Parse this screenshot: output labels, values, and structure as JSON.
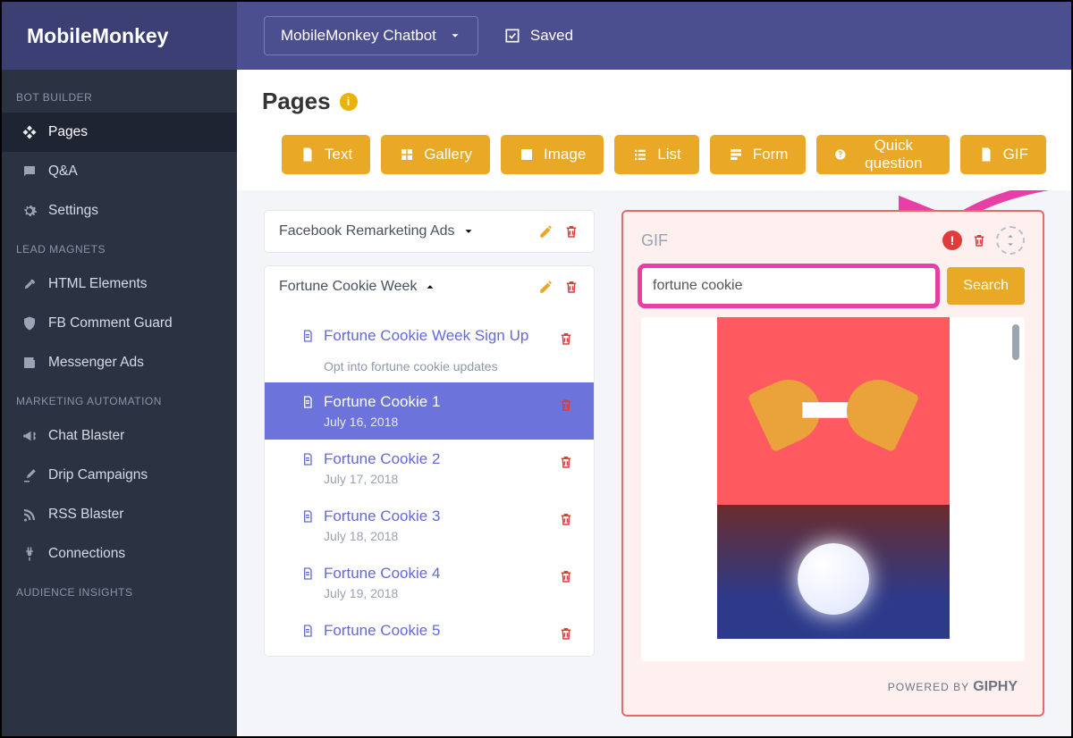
{
  "brand": "MobileMonkey",
  "topbar": {
    "bot_name": "MobileMonkey Chatbot",
    "saved_label": "Saved"
  },
  "sidebar": {
    "sections": [
      {
        "label": "BOT BUILDER",
        "items": [
          {
            "label": "Pages",
            "icon": "diamond-icon",
            "active": true
          },
          {
            "label": "Q&A",
            "icon": "chat-icon"
          },
          {
            "label": "Settings",
            "icon": "gear-icon"
          }
        ]
      },
      {
        "label": "LEAD MAGNETS",
        "items": [
          {
            "label": "HTML Elements",
            "icon": "rocket-icon"
          },
          {
            "label": "FB Comment Guard",
            "icon": "shield-icon"
          },
          {
            "label": "Messenger Ads",
            "icon": "news-icon"
          }
        ]
      },
      {
        "label": "MARKETING AUTOMATION",
        "items": [
          {
            "label": "Chat Blaster",
            "icon": "megaphone-icon"
          },
          {
            "label": "Drip Campaigns",
            "icon": "dropper-icon"
          },
          {
            "label": "RSS Blaster",
            "icon": "rss-icon"
          },
          {
            "label": "Connections",
            "icon": "plug-icon"
          }
        ]
      },
      {
        "label": "AUDIENCE INSIGHTS",
        "items": []
      }
    ]
  },
  "page_header": {
    "title": "Pages"
  },
  "widgets": [
    {
      "label": "Text",
      "icon": "file-icon"
    },
    {
      "label": "Gallery",
      "icon": "grid-icon"
    },
    {
      "label": "Image",
      "icon": "image-icon"
    },
    {
      "label": "List",
      "icon": "list-icon"
    },
    {
      "label": "Form",
      "icon": "form-icon"
    },
    {
      "label": "Quick question",
      "icon": "question-icon"
    },
    {
      "label": "GIF",
      "icon": "file-icon"
    }
  ],
  "groups": [
    {
      "name": "Facebook Remarketing Ads",
      "open": false
    },
    {
      "name": "Fortune Cookie Week",
      "open": true,
      "pages": [
        {
          "title": "Fortune Cookie Week Sign Up",
          "subtext": "Opt into fortune cookie updates"
        },
        {
          "title": "Fortune Cookie 1",
          "date": "July 16, 2018",
          "selected": true
        },
        {
          "title": "Fortune Cookie 2",
          "date": "July 17, 2018"
        },
        {
          "title": "Fortune Cookie 3",
          "date": "July 18, 2018"
        },
        {
          "title": "Fortune Cookie 4",
          "date": "July 19, 2018"
        },
        {
          "title": "Fortune Cookie 5"
        }
      ]
    }
  ],
  "gif_panel": {
    "label": "GIF",
    "search_value": "fortune cookie",
    "search_button": "Search",
    "footer_prefix": "POWERED BY ",
    "footer_brand": "GIPHY"
  }
}
